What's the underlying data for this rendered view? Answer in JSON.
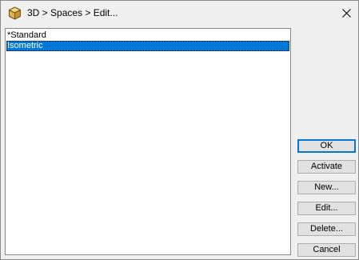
{
  "window": {
    "title": "3D > Spaces > Edit..."
  },
  "icons": {
    "app": "cube-icon",
    "close": "close-icon"
  },
  "list": {
    "items": [
      {
        "label": "*Standard",
        "selected": false
      },
      {
        "label": "Isometric",
        "selected": true
      }
    ]
  },
  "buttons": {
    "ok": "OK",
    "activate": "Activate",
    "new": "New...",
    "edit": "Edit...",
    "delete": "Delete...",
    "cancel": "Cancel"
  },
  "colors": {
    "selection": "#0078d7",
    "dialog_background": "#f0f0f0"
  }
}
